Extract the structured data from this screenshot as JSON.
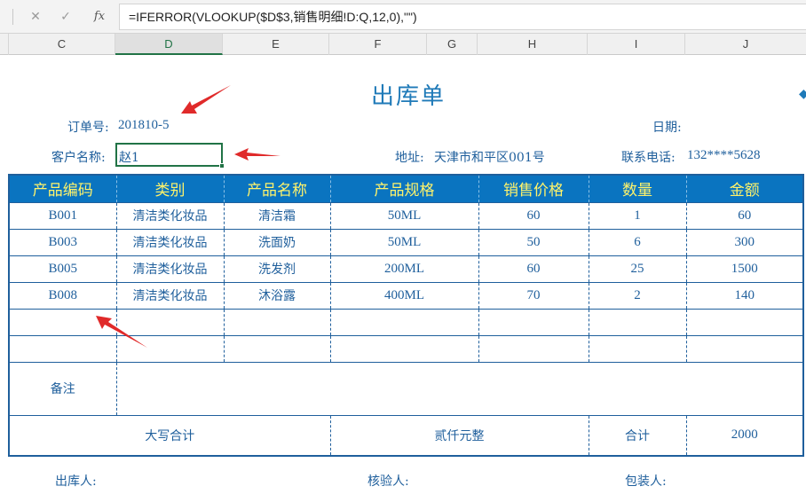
{
  "formula_bar": {
    "cancel_icon": "close-icon",
    "enter_icon": "check-icon",
    "fx_label": "fx",
    "formula": "=IFERROR(VLOOKUP($D$3,销售明细!D:Q,12,0),\"\")"
  },
  "column_headers": [
    "C",
    "D",
    "E",
    "F",
    "G",
    "H",
    "I",
    "J"
  ],
  "selected_column": "D",
  "sheet": {
    "title": "出库单",
    "order_no_label": "订单号:",
    "order_no_value": "201810-5",
    "date_label": "日期:",
    "customer_label": "客户名称:",
    "customer_value": "赵1",
    "address_label": "地址:",
    "address_value": "天津市和平区001号",
    "phone_label": "联系电话:",
    "phone_value": "132****5628"
  },
  "table": {
    "headers": [
      "产品编码",
      "类别",
      "产品名称",
      "产品规格",
      "销售价格",
      "数量",
      "金额"
    ],
    "rows": [
      [
        "B001",
        "清洁类化妆品",
        "清洁霜",
        "50ML",
        "60",
        "1",
        "60"
      ],
      [
        "B003",
        "清洁类化妆品",
        "洗面奶",
        "50ML",
        "50",
        "6",
        "300"
      ],
      [
        "B005",
        "清洁类化妆品",
        "洗发剂",
        "200ML",
        "60",
        "25",
        "1500"
      ],
      [
        "B008",
        "清洁类化妆品",
        "沐浴露",
        "400ML",
        "70",
        "2",
        "140"
      ]
    ],
    "remark_label": "备注",
    "capital_total_label": "大写合计",
    "capital_total_value": "贰仟元整",
    "total_label": "合计",
    "total_value": "2000"
  },
  "footer": {
    "issuer_label": "出库人:",
    "checker_label": "核验人:",
    "packer_label": "包装人:"
  },
  "colors": {
    "header_bg": "#0a74c0",
    "header_text": "#fff36b",
    "body_text": "#1f5f9c",
    "selection": "#217346",
    "arrow": "#e02a2a"
  }
}
